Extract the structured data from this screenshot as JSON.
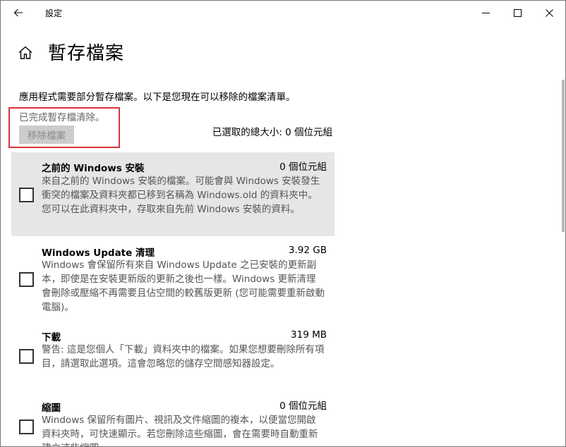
{
  "window": {
    "app_title": "設定",
    "back_icon": "back-arrow-icon",
    "minimize_icon": "minimize-icon",
    "maximize_icon": "maximize-icon",
    "close_icon": "close-icon"
  },
  "header": {
    "home_icon": "home-icon",
    "title": "暫存檔案"
  },
  "main": {
    "description": "應用程式需要部分暫存檔案。以下是您現在可以移除的檔案清單。",
    "status": "已完成暫存檔清除。",
    "remove_button": "移除檔案",
    "total_size": "已選取的總大小: 0 個位元組"
  },
  "items": [
    {
      "name": "之前的 Windows 安裝",
      "size": "0 個位元組",
      "checked": false,
      "description": "來自之前的 Windows 安裝的檔案。可能會與 Windows 安裝發生衝突的檔案及資料夾都已移到名稱為 Windows.old 的資料夾中。您可以在此資料夾中，存取來自先前 Windows 安裝的資料。"
    },
    {
      "name": "Windows Update 清理",
      "size": "3.92 GB",
      "checked": false,
      "description": "Windows 會保留所有來自 Windows Update 之已安裝的更新副本，即使是在安裝更新版的更新之後也一樣。Windows 更新清理會刪除或壓縮不再需要且佔空間的較舊版更新 (您可能需要重新啟動電腦)。"
    },
    {
      "name": "下載",
      "size": "319 MB",
      "checked": false,
      "description": "警告: 這是您個人「下載」資料夾中的檔案。如果您想要刪除所有項目，請選取此選項。這會忽略您的儲存空間感知器設定。"
    },
    {
      "name": "縮圖",
      "size": "0 個位元組",
      "checked": false,
      "description": "Windows 保留所有圖片、視訊及文件縮圖的複本，以便當您開啟資料夾時，可快速顯示。若您刪除這些縮圖，會在需要時自動重新建立這些縮圖。"
    }
  ]
}
